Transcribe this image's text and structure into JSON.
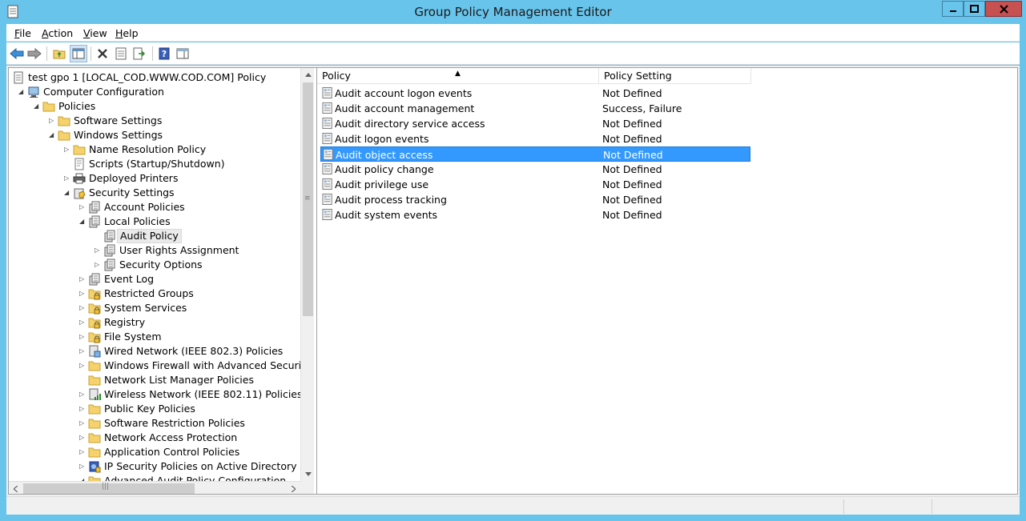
{
  "window": {
    "title": "Group Policy Management Editor"
  },
  "menu": [
    {
      "label": "File",
      "accel": "F",
      "rest": "ile"
    },
    {
      "label": "Action",
      "accel": "A",
      "rest": "ction"
    },
    {
      "label": "View",
      "accel": "V",
      "rest": "iew"
    },
    {
      "label": "Help",
      "accel": "H",
      "rest": "elp"
    }
  ],
  "toolbar": {
    "icons": [
      "back-arrow-icon",
      "forward-arrow-icon",
      "up-folder-icon",
      "show-hide-tree-icon",
      "delete-icon",
      "properties-icon",
      "export-list-icon",
      "help-icon",
      "action-pane-icon"
    ]
  },
  "tree": {
    "items": [
      {
        "label": "test gpo 1 [LOCAL_COD.WWW.COD.COM] Policy",
        "level": 0,
        "expander": "",
        "icon": "gpo-icon"
      },
      {
        "label": "Computer Configuration",
        "level": 1,
        "expander": "expanded",
        "icon": "computer-icon"
      },
      {
        "label": "Policies",
        "level": 2,
        "expander": "expanded",
        "icon": "folder-icon"
      },
      {
        "label": "Software Settings",
        "level": 3,
        "expander": "collapsed",
        "icon": "folder-icon"
      },
      {
        "label": "Windows Settings",
        "level": 3,
        "expander": "expanded",
        "icon": "folder-icon"
      },
      {
        "label": "Name Resolution Policy",
        "level": 4,
        "expander": "collapsed",
        "icon": "folder-icon"
      },
      {
        "label": "Scripts (Startup/Shutdown)",
        "level": 4,
        "expander": "",
        "icon": "scripts-icon"
      },
      {
        "label": "Deployed Printers",
        "level": 4,
        "expander": "collapsed",
        "icon": "printer-icon"
      },
      {
        "label": "Security Settings",
        "level": 4,
        "expander": "expanded",
        "icon": "security-icon"
      },
      {
        "label": "Account Policies",
        "level": 5,
        "expander": "collapsed",
        "icon": "policy-book-icon"
      },
      {
        "label": "Local Policies",
        "level": 5,
        "expander": "expanded",
        "icon": "policy-book-icon"
      },
      {
        "label": "Audit Policy",
        "level": 6,
        "expander": "",
        "icon": "policy-book-icon",
        "selected": true
      },
      {
        "label": "User Rights Assignment",
        "level": 6,
        "expander": "collapsed",
        "icon": "policy-book-icon"
      },
      {
        "label": "Security Options",
        "level": 6,
        "expander": "collapsed",
        "icon": "policy-book-icon"
      },
      {
        "label": "Event Log",
        "level": 5,
        "expander": "collapsed",
        "icon": "policy-book-icon"
      },
      {
        "label": "Restricted Groups",
        "level": 5,
        "expander": "collapsed",
        "icon": "lock-folder-icon"
      },
      {
        "label": "System Services",
        "level": 5,
        "expander": "collapsed",
        "icon": "lock-folder-icon"
      },
      {
        "label": "Registry",
        "level": 5,
        "expander": "collapsed",
        "icon": "lock-folder-icon"
      },
      {
        "label": "File System",
        "level": 5,
        "expander": "collapsed",
        "icon": "lock-folder-icon"
      },
      {
        "label": "Wired Network (IEEE 802.3) Policies",
        "level": 5,
        "expander": "collapsed",
        "icon": "network-icon"
      },
      {
        "label": "Windows Firewall with Advanced Security",
        "level": 5,
        "expander": "collapsed",
        "icon": "folder-icon"
      },
      {
        "label": "Network List Manager Policies",
        "level": 5,
        "expander": "",
        "icon": "folder-icon"
      },
      {
        "label": "Wireless Network (IEEE 802.11) Policies",
        "level": 5,
        "expander": "collapsed",
        "icon": "wireless-icon"
      },
      {
        "label": "Public Key Policies",
        "level": 5,
        "expander": "collapsed",
        "icon": "folder-icon"
      },
      {
        "label": "Software Restriction Policies",
        "level": 5,
        "expander": "collapsed",
        "icon": "folder-icon"
      },
      {
        "label": "Network Access Protection",
        "level": 5,
        "expander": "collapsed",
        "icon": "folder-icon"
      },
      {
        "label": "Application Control Policies",
        "level": 5,
        "expander": "collapsed",
        "icon": "folder-icon"
      },
      {
        "label": "IP Security Policies on Active Directory (WWW.",
        "level": 5,
        "expander": "collapsed",
        "icon": "ipsec-icon"
      },
      {
        "label": "Advanced Audit Policy Configuration",
        "level": 5,
        "expander": "expanded",
        "icon": "folder-icon"
      }
    ]
  },
  "list": {
    "columns": [
      "Policy",
      "Policy Setting"
    ],
    "sort_indicator": "▲",
    "rows": [
      {
        "policy": "Audit account logon events",
        "setting": "Not Defined"
      },
      {
        "policy": "Audit account management",
        "setting": "Success, Failure"
      },
      {
        "policy": "Audit directory service access",
        "setting": "Not Defined"
      },
      {
        "policy": "Audit logon events",
        "setting": "Not Defined"
      },
      {
        "policy": "Audit object access",
        "setting": "Not Defined",
        "selected": true
      },
      {
        "policy": "Audit policy change",
        "setting": "Not Defined"
      },
      {
        "policy": "Audit privilege use",
        "setting": "Not Defined"
      },
      {
        "policy": "Audit process tracking",
        "setting": "Not Defined"
      },
      {
        "policy": "Audit system events",
        "setting": "Not Defined"
      }
    ]
  },
  "colors": {
    "title_bar": "#69c4ec",
    "selection": "#3399ff",
    "close_button": "#c75050",
    "folder": "#f5d26b"
  }
}
